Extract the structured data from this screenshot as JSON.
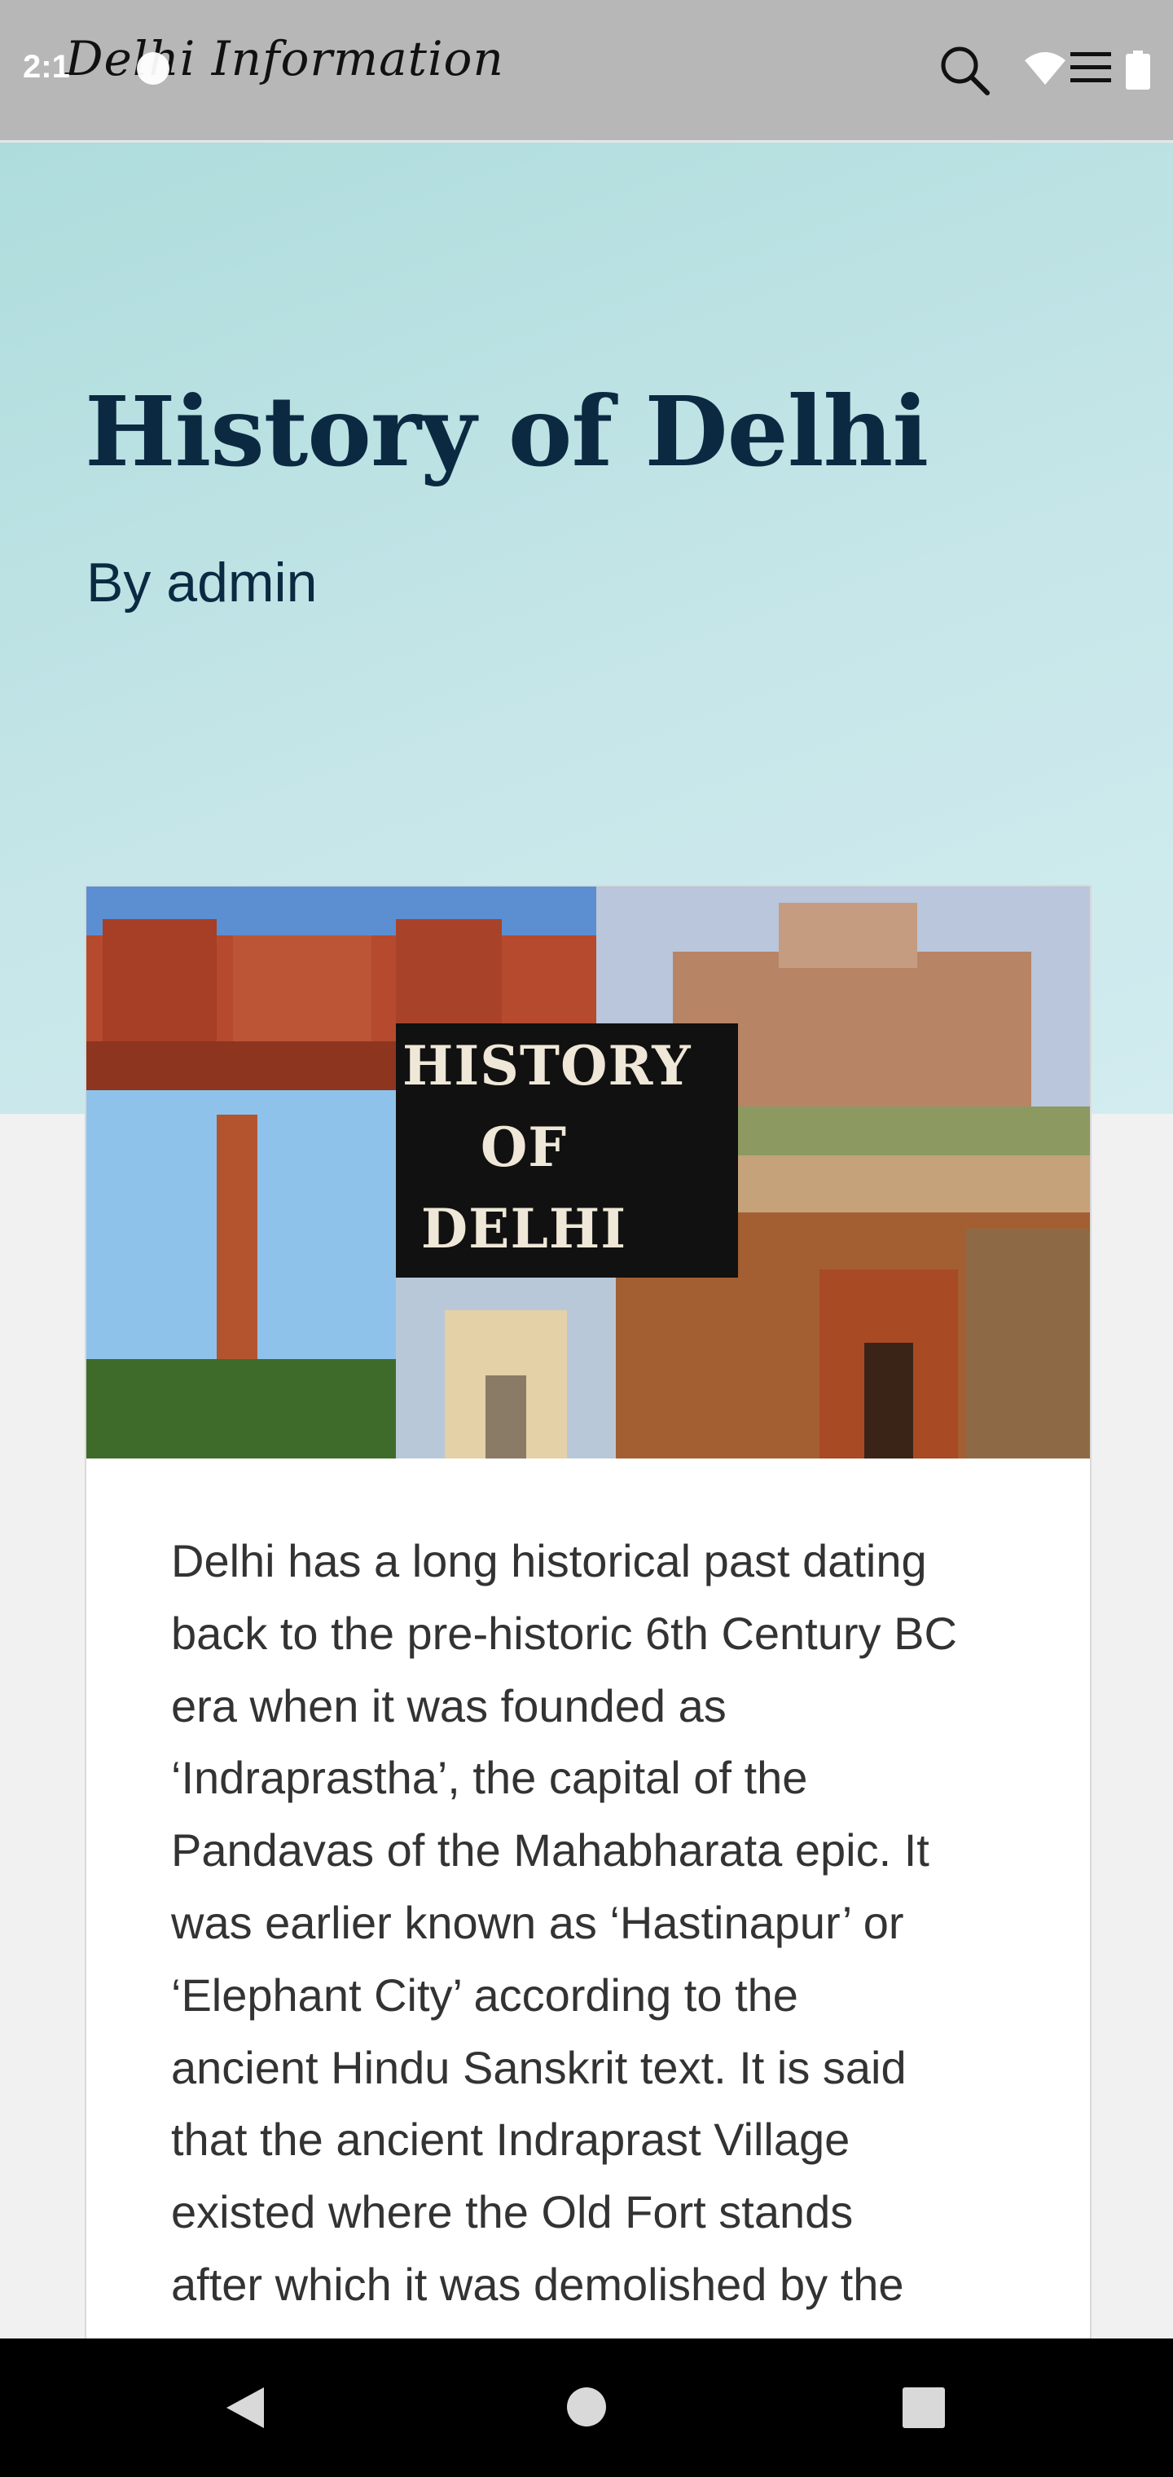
{
  "status_bar": {
    "time": "2:1"
  },
  "header": {
    "logo_text": "Delhi Information",
    "search_icon": "search-icon",
    "menu_icon": "menu-icon"
  },
  "post": {
    "title": "History of Delhi",
    "author": "By admin",
    "feature_image_text": "HISTORY OF DELHI",
    "excerpt_lines": [
      "Delhi has a long historical past dating",
      "back to the pre-historic 6th Century BC",
      "era when it was founded as",
      "‘Indraprastha’, the capital of the",
      "Pandavas of the Mahabharata epic. It",
      "was earlier known as ‘Hastinapur’ or",
      "‘Elephant City’ according to the",
      "ancient Hindu Sanskrit text. It is said",
      "that the ancient Indraprast Village",
      "existed where the Old Fort stands",
      "after which it was demolished by the"
    ]
  },
  "nav": {
    "back_icon": "back-icon",
    "home_icon": "home-icon",
    "recents_icon": "recents-icon"
  },
  "colors": {
    "header_bg": "#b7b7b7",
    "hero_bg": "#b9e0e0",
    "title": "#0b2a42",
    "text": "#333333",
    "navbar_bg": "#000000"
  }
}
